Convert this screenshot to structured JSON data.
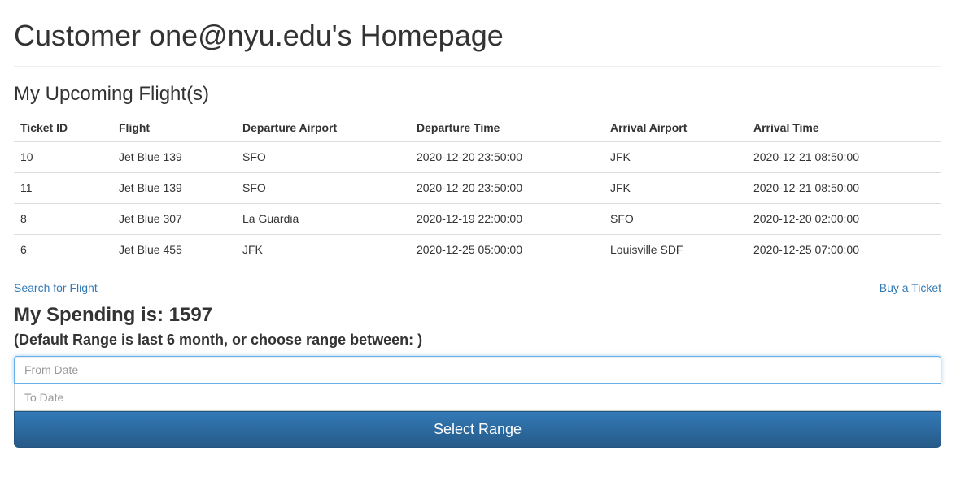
{
  "page": {
    "title": "Customer one@nyu.edu's Homepage"
  },
  "flights_section": {
    "title": "My Upcoming Flight(s)",
    "columns": [
      "Ticket ID",
      "Flight",
      "Departure Airport",
      "Departure Time",
      "Arrival Airport",
      "Arrival Time"
    ],
    "rows": [
      [
        "10",
        "Jet Blue 139",
        "SFO",
        "2020-12-20 23:50:00",
        "JFK",
        "2020-12-21 08:50:00"
      ],
      [
        "11",
        "Jet Blue 139",
        "SFO",
        "2020-12-20 23:50:00",
        "JFK",
        "2020-12-21 08:50:00"
      ],
      [
        "8",
        "Jet Blue 307",
        "La Guardia",
        "2020-12-19 22:00:00",
        "SFO",
        "2020-12-20 02:00:00"
      ],
      [
        "6",
        "Jet Blue 455",
        "JFK",
        "2020-12-25 05:00:00",
        "Louisville SDF",
        "2020-12-25 07:00:00"
      ]
    ]
  },
  "links": {
    "search_flight": "Search for Flight",
    "buy_ticket": "Buy a Ticket"
  },
  "spending": {
    "title": "My Spending is: 1597",
    "range_hint": "(Default Range is last 6 month, or choose range between: )",
    "from_placeholder": "From Date",
    "to_placeholder": "To Date",
    "button_label": "Select Range"
  },
  "colors": {
    "link": "#337ab7",
    "button_top": "#337ab7",
    "button_bottom": "#265a88"
  }
}
